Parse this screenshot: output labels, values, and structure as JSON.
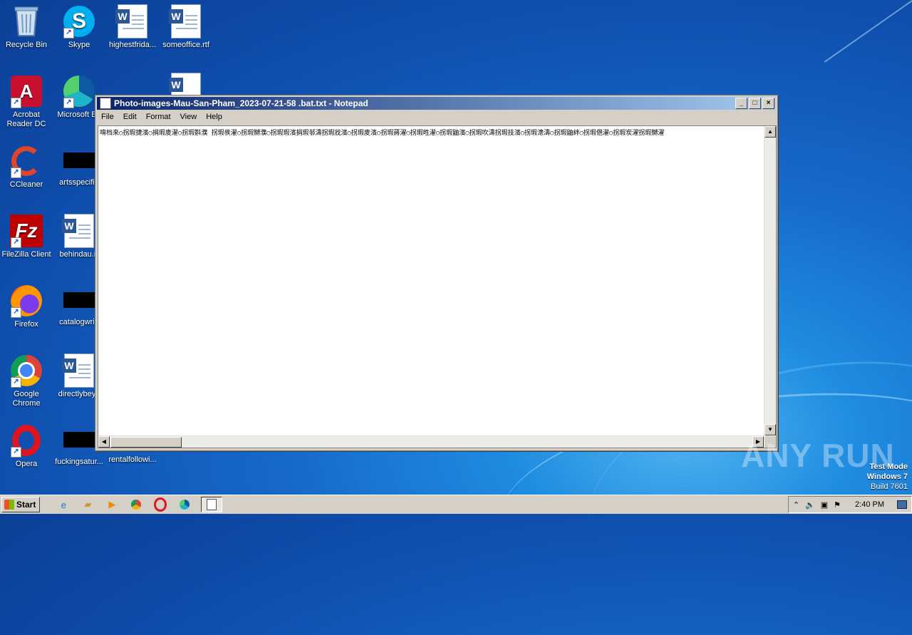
{
  "desktop": {
    "icons": [
      {
        "label": "Recycle Bin"
      },
      {
        "label": "Skype"
      },
      {
        "label": "highestfrida..."
      },
      {
        "label": "someoffice.rtf"
      },
      {
        "label": "Acrobat Reader DC"
      },
      {
        "label": "Microsoft Ed"
      },
      {
        "label": "CCleaner"
      },
      {
        "label": "artsspecifie"
      },
      {
        "label": "FileZilla Client"
      },
      {
        "label": "behindau.rt"
      },
      {
        "label": "Firefox"
      },
      {
        "label": "catalogwritt"
      },
      {
        "label": "Google Chrome"
      },
      {
        "label": "directlybeyo"
      },
      {
        "label": "Opera"
      },
      {
        "label": "fuckingsatur..."
      },
      {
        "label": "rentalfollowi..."
      }
    ]
  },
  "notepad": {
    "title": "Photo-images-Mau-San-Pham_2023-07-21-58 .bat.txt - Notepad",
    "menu": [
      "File",
      "Edit",
      "Format",
      "View",
      "Help"
    ],
    "content": "唷档來○拐瑕捷濱○捐瑕庱濯○拐瑕斟濮 拐瑕彂濯○拐瑕嬲濮○拐瑕瑕濱捐瑕邿濤拐瑕戕濱○拐瑕庱濱○拐瑕蔣濯○拐瑕甠濯○拐瑕鼬濱○拐瑕吹濤拐瑕技濱○拐瑕漶濤○拐瑕鼬絆○拐瑕俋濯○拐瑕炭濯拐瑕嬲濯"
  },
  "watermark": {
    "logo": "ANY RUN",
    "test_mode": "Test Mode",
    "os": "Windows 7",
    "build": "Build 7601"
  },
  "taskbar": {
    "start_label": "Start",
    "clock": "2:40 PM"
  }
}
